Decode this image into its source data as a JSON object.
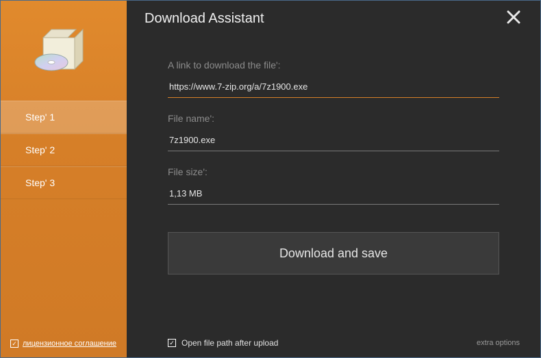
{
  "app": {
    "title": "Download Assistant"
  },
  "sidebar": {
    "steps": [
      {
        "label": "Step' 1",
        "active": true
      },
      {
        "label": "Step' 2",
        "active": false
      },
      {
        "label": "Step' 3",
        "active": false
      }
    ],
    "license_checked": true,
    "license_label": "лицензионное соглашение"
  },
  "form": {
    "link_label": "A link to download the file':",
    "link_value": "https://www.7-zip.org/a/7z1900.exe",
    "filename_label": "File name':",
    "filename_value": "7z1900.exe",
    "filesize_label": "File size':",
    "filesize_value": "1,13 MB",
    "download_button": "Download and save"
  },
  "footer": {
    "open_path_checked": true,
    "open_path_label": "Open file path after upload",
    "extra_options": "extra options"
  },
  "colors": {
    "accent": "#d67f28",
    "bg": "#2b2b2b"
  }
}
